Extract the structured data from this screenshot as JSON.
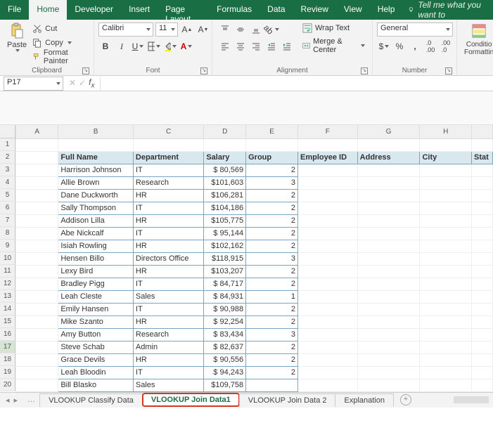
{
  "menu": {
    "tabs": [
      "File",
      "Home",
      "Developer",
      "Insert",
      "Page Layout",
      "Formulas",
      "Data",
      "Review",
      "View",
      "Help"
    ],
    "active_index": 1,
    "tell_me": "Tell me what you want to"
  },
  "ribbon": {
    "clipboard": {
      "paste": "Paste",
      "cut": "Cut",
      "copy": "Copy",
      "format_painter": "Format Painter",
      "label": "Clipboard"
    },
    "font": {
      "name": "Calibri",
      "size": "11",
      "label": "Font"
    },
    "alignment": {
      "wrap": "Wrap Text",
      "merge": "Merge & Center",
      "label": "Alignment"
    },
    "number": {
      "format": "General",
      "label": "Number"
    },
    "styles": {
      "conditional": "Conditio",
      "formatting": "Formattin"
    }
  },
  "namebox": "P17",
  "columns": [
    "A",
    "B",
    "C",
    "D",
    "E",
    "F",
    "G",
    "H",
    "Stat"
  ],
  "header_row": {
    "B": "Full Name",
    "C": "Department",
    "D": "Salary",
    "E": "Group",
    "F": "Employee ID",
    "G": "Address",
    "H": "City",
    "I": "Stat"
  },
  "rows": [
    {
      "name": "Harrison Johnson",
      "dept": "IT",
      "salary": "$  80,569",
      "group": "2"
    },
    {
      "name": "Allie Brown",
      "dept": "Research",
      "salary": "$101,603",
      "group": "3"
    },
    {
      "name": "Dane Duckworth",
      "dept": "HR",
      "salary": "$106,281",
      "group": "2"
    },
    {
      "name": "Sally Thompson",
      "dept": "IT",
      "salary": "$104,186",
      "group": "2"
    },
    {
      "name": "Addison Lilla",
      "dept": "HR",
      "salary": "$105,775",
      "group": "2"
    },
    {
      "name": "Abe Nickcalf",
      "dept": "IT",
      "salary": "$  95,144",
      "group": "2"
    },
    {
      "name": "Isiah Rowling",
      "dept": "HR",
      "salary": "$102,162",
      "group": "2"
    },
    {
      "name": "Hensen Billo",
      "dept": "Directors Office",
      "salary": "$118,915",
      "group": "3"
    },
    {
      "name": "Lexy Bird",
      "dept": "HR",
      "salary": "$103,207",
      "group": "2"
    },
    {
      "name": "Bradley Pigg",
      "dept": "IT",
      "salary": "$  84,717",
      "group": "2"
    },
    {
      "name": "Leah Cleste",
      "dept": "Sales",
      "salary": "$  84,931",
      "group": "1"
    },
    {
      "name": "Emily Hansen",
      "dept": "IT",
      "salary": "$  90,988",
      "group": "2"
    },
    {
      "name": "Mike Szanto",
      "dept": "HR",
      "salary": "$  92,254",
      "group": "2"
    },
    {
      "name": "Amy Button",
      "dept": "Research",
      "salary": "$  83,434",
      "group": "3"
    },
    {
      "name": "Steve Schab",
      "dept": "Admin",
      "salary": "$  82,637",
      "group": "2"
    },
    {
      "name": "Grace Devils",
      "dept": "HR",
      "salary": "$  90,556",
      "group": "2"
    },
    {
      "name": "Leah Bloodin",
      "dept": "IT",
      "salary": "$  94,243",
      "group": "2"
    },
    {
      "name": "Bill Blasko",
      "dept": "Sales",
      "salary": "$109,758",
      "group": ""
    }
  ],
  "sheet_tabs": {
    "items": [
      "VLOOKUP Classify Data",
      "VLOOKUP Join Data1",
      "VLOOKUP Join Data 2",
      "Explanation"
    ],
    "active_index": 1
  },
  "selected_row_header": 17
}
